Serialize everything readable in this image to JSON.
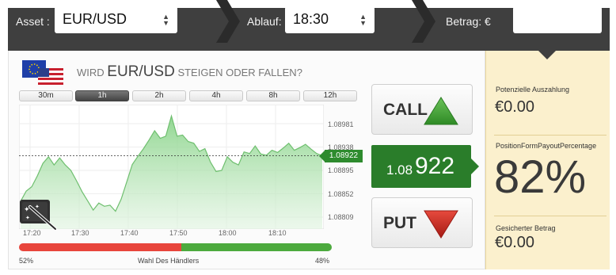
{
  "topbar": {
    "asset_label": "Asset :",
    "asset_value": "EUR/USD",
    "expiry_label": "Ablauf:",
    "expiry_value": "18:30",
    "amount_label": "Betrag: €",
    "amount_value": ""
  },
  "question": {
    "prefix": "WIRD",
    "asset": "EUR/USD",
    "suffix": "STEIGEN ODER FALLEN?"
  },
  "timeframes": [
    {
      "label": "30m",
      "active": false
    },
    {
      "label": "1h",
      "active": true
    },
    {
      "label": "2h",
      "active": false
    },
    {
      "label": "4h",
      "active": false
    },
    {
      "label": "8h",
      "active": false
    },
    {
      "label": "12h",
      "active": false
    }
  ],
  "chart_data": {
    "type": "area",
    "x_ticks": [
      "17:20",
      "17:30",
      "17:40",
      "17:50",
      "18:00",
      "18:10"
    ],
    "y_ticks": [
      "1.08981",
      "1.08938",
      "1.08895",
      "1.08852",
      "1.08809"
    ],
    "ylim": [
      1.08809,
      1.08981
    ],
    "current_price": "1.08922",
    "values": [
      1.08838,
      1.08857,
      1.08865,
      1.08885,
      1.08908,
      1.0892,
      1.08905,
      1.08918,
      1.08905,
      1.08895,
      1.08876,
      1.08856,
      1.08839,
      1.08822,
      1.08835,
      1.08829,
      1.08831,
      1.0882,
      1.08842,
      1.08874,
      1.08906,
      1.08921,
      1.08935,
      1.08951,
      1.08968,
      1.08954,
      1.08958,
      1.08995,
      1.08958,
      1.0896,
      1.08948,
      1.08945,
      1.0893,
      1.08935,
      1.0891,
      1.08893,
      1.08895,
      1.0892,
      1.0891,
      1.08905,
      1.08929,
      1.08926,
      1.0894,
      1.08925,
      1.08923,
      1.08932,
      1.08928,
      1.08936,
      1.08945,
      1.08932,
      1.08937,
      1.08943,
      1.08934,
      1.08926,
      1.08922
    ],
    "grid": true
  },
  "buttons": {
    "call_label": "CALL",
    "put_label": "PUT"
  },
  "price": {
    "prefix": "1.08",
    "suffix": "922"
  },
  "sentiment": {
    "left_pct": "52%",
    "label": "Wahl Des Händlers",
    "right_pct": "48%",
    "put_fraction": 0.52,
    "call_fraction": 0.48
  },
  "side": {
    "payout_label": "Potenzielle Auszahlung",
    "payout_value": "€0.00",
    "percentage_label": "PositionFormPayoutPercentage",
    "percentage_value": "82%",
    "secured_label": "Gesicherter Betrag",
    "secured_value": "€0.00"
  },
  "colors": {
    "topbar": "#3f3f3f",
    "accent_green": "#2a7d2a",
    "put_red": "#e8453c",
    "call_green": "#4caa3d",
    "side_panel": "#fbf0cd"
  }
}
